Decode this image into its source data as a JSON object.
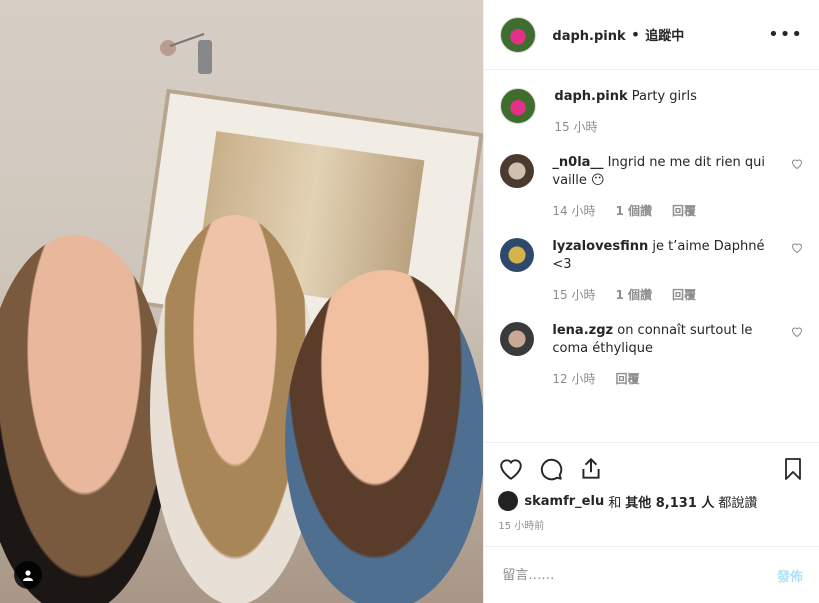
{
  "post": {
    "author": "daph.pink",
    "follow_status": "追蹤中",
    "separator": "•",
    "caption_user": "daph.pink",
    "caption_text": "Party girls",
    "caption_time": "15 小時"
  },
  "comments": [
    {
      "user": "_n0la__",
      "text": "Ingrid ne me dit rien qui vaille 😶",
      "time": "14 小時",
      "likes": "1 個讚",
      "reply": "回覆"
    },
    {
      "user": "lyzalovesfinn",
      "text": "je t’aime Daphné <3",
      "time": "15 小時",
      "likes": "1 個讚",
      "reply": "回覆"
    },
    {
      "user": "lena.zgz",
      "text": "on connaît surtout le coma éthylique",
      "time": "12 小時",
      "likes": "",
      "reply": "回覆"
    }
  ],
  "likes_line": {
    "user": "skamfr_elu",
    "and": "和",
    "others": "其他 8,131 人",
    "suffix": "都說讚"
  },
  "timestamp": "15 小時前",
  "add_comment": {
    "placeholder": "留言……",
    "post_label": "發佈"
  },
  "colors": {
    "link_disabled": "#b2dffc",
    "secondary_text": "#8e8e8e",
    "primary_text": "#262626"
  },
  "icons": [
    "more-options-icon",
    "heart-icon",
    "comment-icon",
    "share-icon",
    "bookmark-icon",
    "person-tag-icon"
  ]
}
